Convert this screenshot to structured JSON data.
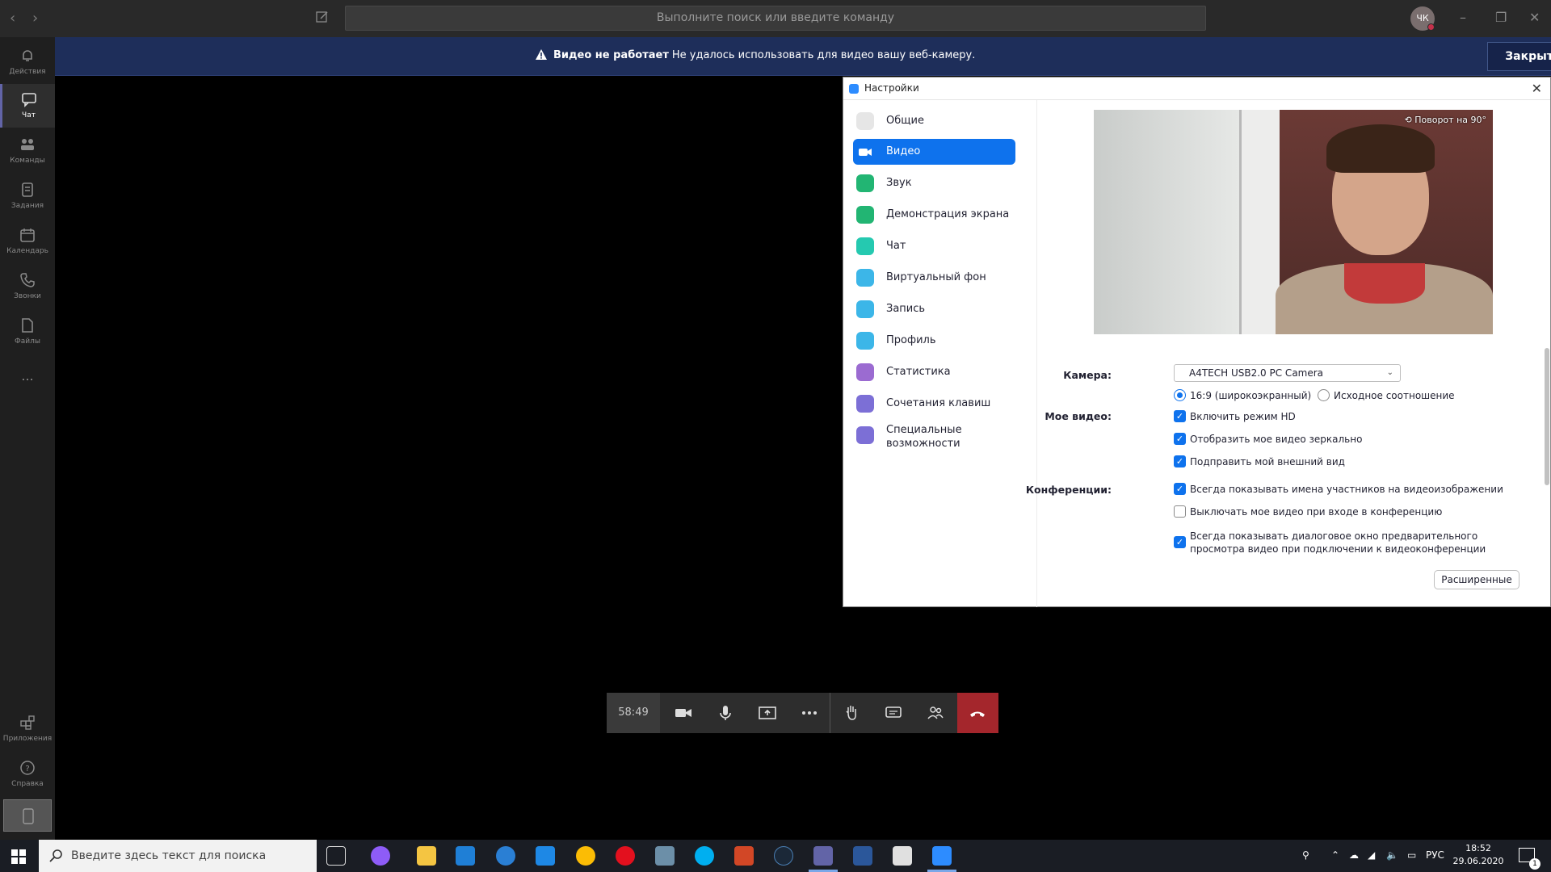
{
  "titlebar": {
    "search_placeholder": "Выполните поиск или введите команду",
    "avatar_initials": "ЧК"
  },
  "rail": {
    "items": [
      {
        "label": "Действия",
        "icon": "bell-icon"
      },
      {
        "label": "Чат",
        "icon": "chat-icon"
      },
      {
        "label": "Команды",
        "icon": "teams-icon"
      },
      {
        "label": "Задания",
        "icon": "assignments-icon"
      },
      {
        "label": "Календарь",
        "icon": "calendar-icon"
      },
      {
        "label": "Звонки",
        "icon": "phone-icon"
      },
      {
        "label": "Файлы",
        "icon": "files-icon"
      },
      {
        "label": "...",
        "icon": "more-icon"
      }
    ],
    "bottom": [
      {
        "label": "Приложения",
        "icon": "apps-icon"
      },
      {
        "label": "Справка",
        "icon": "help-icon"
      }
    ]
  },
  "banner": {
    "title": "Видео не работает",
    "text": "Не удалось использовать для видео вашу веб-камеру.",
    "close_label": "Закрыть"
  },
  "settings": {
    "window_title": "Настройки",
    "menu": [
      {
        "label": "Общие",
        "icon": "gear-icon",
        "color": "#c8c8c8"
      },
      {
        "label": "Видео",
        "icon": "video-camera-icon",
        "color": "#ffffff"
      },
      {
        "label": "Звук",
        "icon": "headphones-icon",
        "color": "#22b573"
      },
      {
        "label": "Демонстрация экрана",
        "icon": "share-screen-icon",
        "color": "#22b573"
      },
      {
        "label": "Чат",
        "icon": "chat-bubble-icon",
        "color": "#25c9b0"
      },
      {
        "label": "Виртуальный фон",
        "icon": "virtual-background-icon",
        "color": "#3cb6e8"
      },
      {
        "label": "Запись",
        "icon": "record-icon",
        "color": "#3cb6e8"
      },
      {
        "label": "Профиль",
        "icon": "profile-icon",
        "color": "#3cb6e8"
      },
      {
        "label": "Статистика",
        "icon": "statistics-icon",
        "color": "#9b6bd1"
      },
      {
        "label": "Сочетания клавиш",
        "icon": "keyboard-icon",
        "color": "#7c6fd6"
      },
      {
        "label": "Специальные возможности",
        "icon": "accessibility-icon",
        "color": "#7c6fd6"
      }
    ],
    "rotate_label": "Поворот на 90°",
    "camera_label": "Камера:",
    "camera_value": "A4TECH USB2.0 PC Camera",
    "ratio_widescreen": "16:9 (широкоэкранный)",
    "ratio_original": "Исходное соотношение",
    "my_video_label": "Мое видео:",
    "opt_hd": "Включить режим HD",
    "opt_mirror": "Отобразить мое видео зеркально",
    "opt_touchup": "Подправить мой внешний вид",
    "meetings_label": "Конференции:",
    "opt_names": "Всегда показывать имена участников на видеоизображении",
    "opt_turnoff": "Выключать мое видео при входе в конференцию",
    "opt_preview": "Всегда показывать диалоговое окно предварительного просмотра видео при подключении к видеоконференции",
    "advanced_label": "Расширенные"
  },
  "call": {
    "timer": "58:49"
  },
  "taskbar": {
    "search_placeholder": "Введите здесь текст для поиска",
    "lang": "РУС",
    "time": "18:52",
    "date": "29.06.2020",
    "notif_count": "1"
  }
}
